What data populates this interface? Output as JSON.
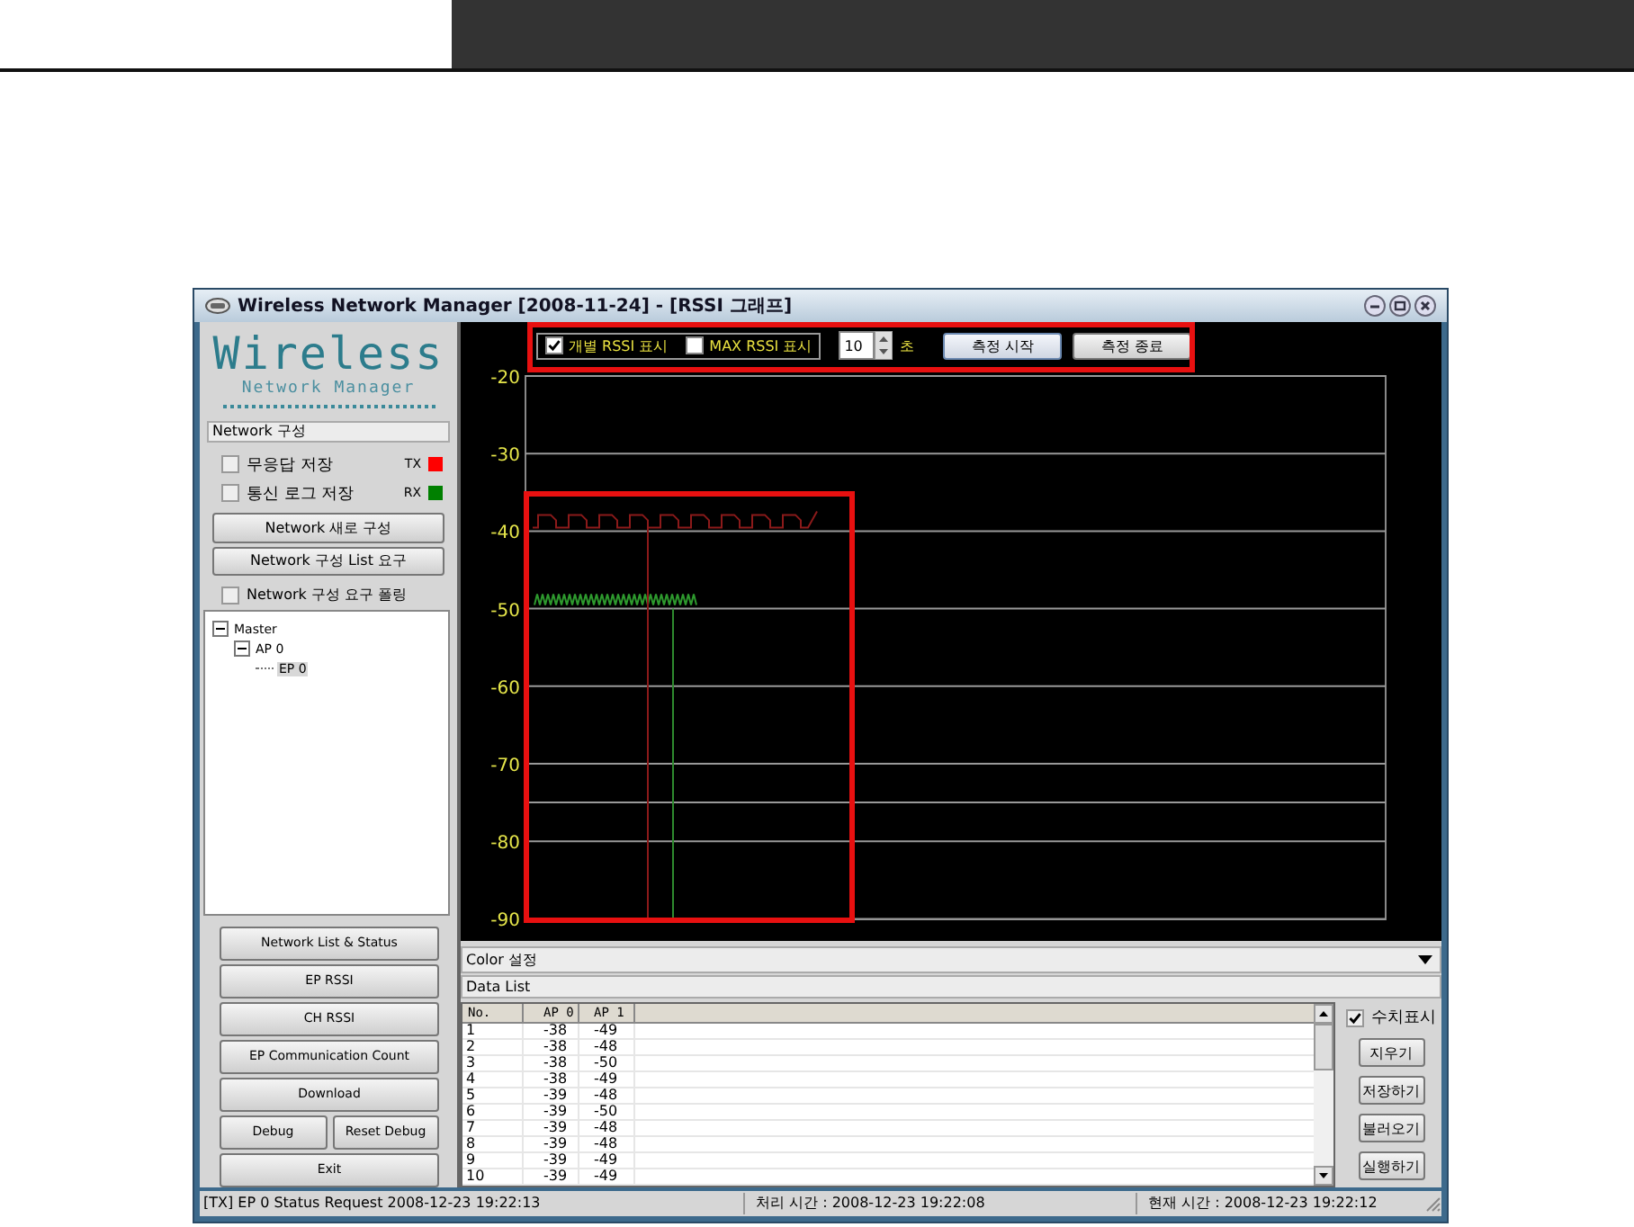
{
  "window": {
    "title": "Wireless Network Manager [2008-11-24] - [RSSI 그래프]"
  },
  "sidebar": {
    "logo_title": "Wireless",
    "logo_subtitle": "Network Manager",
    "group_title": "Network 구성",
    "options": [
      {
        "label": "무응답 저장",
        "checked": false
      },
      {
        "label": "통신 로그 저장",
        "checked": false
      }
    ],
    "legend": [
      {
        "label": "TX",
        "color": "#ff0000"
      },
      {
        "label": "RX",
        "color": "#008000"
      }
    ],
    "actions": [
      "Network 새로 구성",
      "Network 구성 List 요구"
    ],
    "polling": {
      "label": "Network 구성 요구 폴링",
      "checked": false
    },
    "tree": [
      {
        "label": "Master",
        "expanded": true,
        "selected": false,
        "children": [
          {
            "label": "AP 0",
            "expanded": true,
            "selected": false,
            "children": [
              {
                "label": "EP 0",
                "selected": true
              }
            ]
          }
        ]
      }
    ],
    "nav_buttons": [
      [
        "Network List & Status"
      ],
      [
        "EP RSSI"
      ],
      [
        "CH RSSI"
      ],
      [
        "EP Communication Count"
      ],
      [
        "Download"
      ],
      [
        "Debug",
        "Reset Debug"
      ],
      [
        "Exit"
      ]
    ]
  },
  "graph": {
    "toolbar": {
      "options": [
        {
          "label": "개별 RSSI 표시",
          "checked": true
        },
        {
          "label": "MAX RSSI 표시",
          "checked": false
        }
      ],
      "interval": "10",
      "interval_unit": "초",
      "buttons": [
        "측정 시작",
        "측정 종료"
      ]
    },
    "y_axis_labels": [
      "-20",
      "-30",
      "-40",
      "-50",
      "-60",
      "-70",
      "-80",
      "-90"
    ]
  },
  "color_setting": "Color 설정",
  "data_list": {
    "title": "Data List",
    "columns": [
      "No.",
      "AP 0",
      "AP 1"
    ],
    "rows": [
      [
        "1",
        "-38",
        "-49"
      ],
      [
        "2",
        "-38",
        "-48"
      ],
      [
        "3",
        "-38",
        "-50"
      ],
      [
        "4",
        "-38",
        "-49"
      ],
      [
        "5",
        "-39",
        "-48"
      ],
      [
        "6",
        "-39",
        "-50"
      ],
      [
        "7",
        "-39",
        "-48"
      ],
      [
        "8",
        "-39",
        "-48"
      ],
      [
        "9",
        "-39",
        "-49"
      ],
      [
        "10",
        "-39",
        "-49"
      ]
    ],
    "show_values": {
      "label": "수치표시",
      "checked": true
    },
    "buttons": [
      "지우기",
      "저장하기",
      "불러오기",
      "실행하기"
    ]
  },
  "status_bar": [
    "[TX] EP 0  Status Request 2008-12-23 19:22:13",
    "처리 시간 : 2008-12-23 19:22:08",
    "현재 시간 : 2008-12-23 19:22:12"
  ]
}
